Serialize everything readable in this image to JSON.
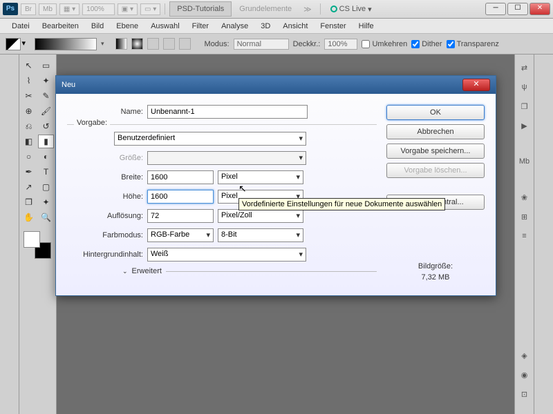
{
  "titlebar": {
    "br": "Br",
    "mb": "Mb",
    "zoom": "100%",
    "tabs": [
      "PSD-Tutorials",
      "Grundelemente"
    ],
    "cslive": "CS Live"
  },
  "menu": [
    "Datei",
    "Bearbeiten",
    "Bild",
    "Ebene",
    "Auswahl",
    "Filter",
    "Analyse",
    "3D",
    "Ansicht",
    "Fenster",
    "Hilfe"
  ],
  "optbar": {
    "modus_label": "Modus:",
    "modus_value": "Normal",
    "deckkr_label": "Deckkr.:",
    "deckkr_value": "100%",
    "umkehren": "Umkehren",
    "dither": "Dither",
    "transparenz": "Transparenz"
  },
  "dialog": {
    "title": "Neu",
    "name_label": "Name:",
    "name_value": "Unbenannt-1",
    "vorgabe_label": "Vorgabe:",
    "vorgabe_value": "Benutzerdefiniert",
    "groesse_label": "Größe:",
    "breite_label": "Breite:",
    "breite_value": "1600",
    "breite_unit": "Pixel",
    "hoehe_label": "Höhe:",
    "hoehe_value": "1600",
    "hoehe_unit": "Pixel",
    "aufloesung_label": "Auflösung:",
    "aufloesung_value": "72",
    "aufloesung_unit": "Pixel/Zoll",
    "farbmodus_label": "Farbmodus:",
    "farbmodus_value": "RGB-Farbe",
    "farbmodus_bit": "8-Bit",
    "hintergrund_label": "Hintergrundinhalt:",
    "hintergrund_value": "Weiß",
    "erweitert": "Erweitert",
    "ok": "OK",
    "abbrechen": "Abbrechen",
    "speichern": "Vorgabe speichern...",
    "loeschen": "Vorgabe löschen...",
    "device": "Device Central...",
    "bildgroesse_label": "Bildgröße:",
    "bildgroesse_value": "7,32 MB"
  },
  "tooltip": "Vordefinierte Einstellungen für neue Dokumente auswählen"
}
